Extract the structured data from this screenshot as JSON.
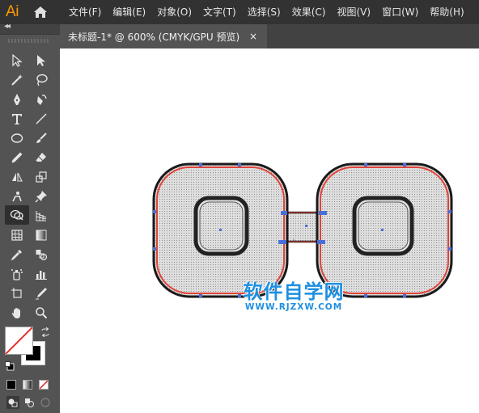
{
  "app": {
    "logo_text": "Ai",
    "logo_color": "#ff9a00"
  },
  "menu": {
    "items": [
      {
        "label": "文件(F)"
      },
      {
        "label": "编辑(E)"
      },
      {
        "label": "对象(O)"
      },
      {
        "label": "文字(T)"
      },
      {
        "label": "选择(S)"
      },
      {
        "label": "效果(C)"
      },
      {
        "label": "视图(V)"
      },
      {
        "label": "窗口(W)"
      },
      {
        "label": "帮助(H)"
      }
    ]
  },
  "document_tab": {
    "title": "未标题-1* @ 600% (CMYK/GPU 预览)",
    "close_label": "×"
  },
  "panel": {
    "collapse_label": "◂◂"
  },
  "tools": [
    "selection-tool",
    "direct-selection-tool",
    "magic-wand-tool",
    "lasso-tool",
    "pen-tool",
    "curvature-tool",
    "type-tool",
    "line-segment-tool",
    "ellipse-tool",
    "paintbrush-tool",
    "pencil-tool",
    "eraser-tool",
    "reflect-tool",
    "scale-tool",
    "puppet-warp-tool",
    "pin-tool",
    "shape-builder-tool",
    "perspective-grid-tool",
    "mesh-tool",
    "gradient-tool",
    "eyedropper-tool",
    "blend-tool",
    "symbol-sprayer-tool",
    "column-graph-tool",
    "artboard-tool",
    "slice-tool",
    "hand-tool",
    "zoom-tool"
  ],
  "colors": {
    "shape_fill": "#d9d9d9",
    "shape_stroke_red": "#e0443a",
    "shape_stroke_black": "#1a1a1a",
    "anchor_blue": "#4a6fd8",
    "watermark_blue": "#1e8fe0"
  },
  "watermark": {
    "title": "软件自学网",
    "url": "WWW.RJZXW.COM"
  }
}
